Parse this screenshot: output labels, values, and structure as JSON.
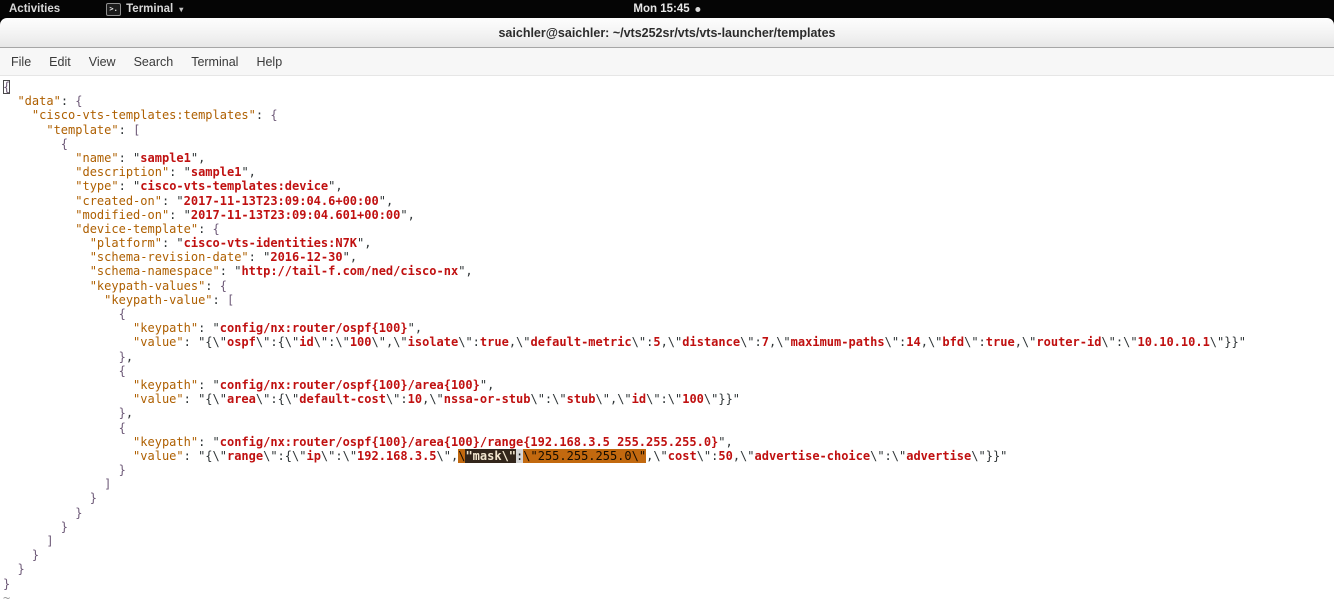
{
  "top_bar": {
    "activities": "Activities",
    "app_menu": "Terminal",
    "clock": "Mon 15:45"
  },
  "window": {
    "title": "saichler@saichler: ~/vts252sr/vts/vts-launcher/templates"
  },
  "menu_bar": {
    "items": [
      "File",
      "Edit",
      "View",
      "Search",
      "Terminal",
      "Help"
    ]
  },
  "colors": {
    "key": "#ae5f00",
    "str": "#c01010",
    "brace": "#6e5a78",
    "pun": "#2e3436",
    "sel": "#c2690f",
    "match": "#33261b"
  },
  "terminal": {
    "search_match": "\"mask\\\"",
    "selection_text": "\\\"mask\\\":\\\"255.255.255.0\\\"",
    "lines": [
      [
        [
          "b",
          "{",
          "cur"
        ]
      ],
      [
        [
          "p",
          "  "
        ],
        [
          "k",
          "\"data\""
        ],
        [
          "p",
          ": "
        ],
        [
          "b",
          "{"
        ]
      ],
      [
        [
          "p",
          "    "
        ],
        [
          "k",
          "\"cisco-vts-templates:templates\""
        ],
        [
          "p",
          ": "
        ],
        [
          "b",
          "{"
        ]
      ],
      [
        [
          "p",
          "      "
        ],
        [
          "k",
          "\"template\""
        ],
        [
          "p",
          ": "
        ],
        [
          "b",
          "["
        ]
      ],
      [
        [
          "p",
          "        "
        ],
        [
          "b",
          "{"
        ]
      ],
      [
        [
          "p",
          "          "
        ],
        [
          "k",
          "\"name\""
        ],
        [
          "p",
          ": \""
        ],
        [
          "s",
          "sample1"
        ],
        [
          "p",
          "\","
        ]
      ],
      [
        [
          "p",
          "          "
        ],
        [
          "k",
          "\"description\""
        ],
        [
          "p",
          ": \""
        ],
        [
          "s",
          "sample1"
        ],
        [
          "p",
          "\","
        ]
      ],
      [
        [
          "p",
          "          "
        ],
        [
          "k",
          "\"type\""
        ],
        [
          "p",
          ": \""
        ],
        [
          "s",
          "cisco-vts-templates:device"
        ],
        [
          "p",
          "\","
        ]
      ],
      [
        [
          "p",
          "          "
        ],
        [
          "k",
          "\"created-on\""
        ],
        [
          "p",
          ": \""
        ],
        [
          "s",
          "2017-11-13T23:09:04.6+00:00"
        ],
        [
          "p",
          "\","
        ]
      ],
      [
        [
          "p",
          "          "
        ],
        [
          "k",
          "\"modified-on\""
        ],
        [
          "p",
          ": \""
        ],
        [
          "s",
          "2017-11-13T23:09:04.601+00:00"
        ],
        [
          "p",
          "\","
        ]
      ],
      [
        [
          "p",
          "          "
        ],
        [
          "k",
          "\"device-template\""
        ],
        [
          "p",
          ": "
        ],
        [
          "b",
          "{"
        ]
      ],
      [
        [
          "p",
          "            "
        ],
        [
          "k",
          "\"platform\""
        ],
        [
          "p",
          ": \""
        ],
        [
          "s",
          "cisco-vts-identities:N7K"
        ],
        [
          "p",
          "\","
        ]
      ],
      [
        [
          "p",
          "            "
        ],
        [
          "k",
          "\"schema-revision-date\""
        ],
        [
          "p",
          ": \""
        ],
        [
          "s",
          "2016-12-30"
        ],
        [
          "p",
          "\","
        ]
      ],
      [
        [
          "p",
          "            "
        ],
        [
          "k",
          "\"schema-namespace\""
        ],
        [
          "p",
          ": \""
        ],
        [
          "s",
          "http://tail-f.com/ned/cisco-nx"
        ],
        [
          "p",
          "\","
        ]
      ],
      [
        [
          "p",
          "            "
        ],
        [
          "k",
          "\"keypath-values\""
        ],
        [
          "p",
          ": "
        ],
        [
          "b",
          "{"
        ]
      ],
      [
        [
          "p",
          "              "
        ],
        [
          "k",
          "\"keypath-value\""
        ],
        [
          "p",
          ": "
        ],
        [
          "b",
          "["
        ]
      ],
      [
        [
          "p",
          "                "
        ],
        [
          "b",
          "{"
        ]
      ],
      [
        [
          "p",
          "                  "
        ],
        [
          "k",
          "\"keypath\""
        ],
        [
          "p",
          ": \""
        ],
        [
          "s",
          "config/nx:router/ospf{100}"
        ],
        [
          "p",
          "\","
        ]
      ],
      [
        [
          "p",
          "                  "
        ],
        [
          "k",
          "\"value\""
        ],
        [
          "p",
          ": \"{\\\""
        ],
        [
          "s",
          "ospf"
        ],
        [
          "p",
          "\\\":{\\\""
        ],
        [
          "s",
          "id"
        ],
        [
          "p",
          "\\\":\\\""
        ],
        [
          "s",
          "100"
        ],
        [
          "p",
          "\\\",\\\""
        ],
        [
          "s",
          "isolate"
        ],
        [
          "p",
          "\\\":"
        ],
        [
          "s",
          "true"
        ],
        [
          "p",
          ",\\\""
        ],
        [
          "s",
          "default-metric"
        ],
        [
          "p",
          "\\\":"
        ],
        [
          "s",
          "5"
        ],
        [
          "p",
          ",\\\""
        ],
        [
          "s",
          "distance"
        ],
        [
          "p",
          "\\\":"
        ],
        [
          "s",
          "7"
        ],
        [
          "p",
          ",\\\""
        ],
        [
          "s",
          "maximum-paths"
        ],
        [
          "p",
          "\\\":"
        ],
        [
          "s",
          "14"
        ],
        [
          "p",
          ",\\\""
        ],
        [
          "s",
          "bfd"
        ],
        [
          "p",
          "\\\":"
        ],
        [
          "s",
          "true"
        ],
        [
          "p",
          ",\\\""
        ],
        [
          "s",
          "router-id"
        ],
        [
          "p",
          "\\\":\\\""
        ],
        [
          "s",
          "10.10.10.1"
        ],
        [
          "p",
          "\\\"}}\""
        ]
      ],
      [
        [
          "p",
          "                "
        ],
        [
          "b",
          "}"
        ],
        [
          "p",
          ","
        ]
      ],
      [
        [
          "p",
          "                "
        ],
        [
          "b",
          "{"
        ]
      ],
      [
        [
          "p",
          "                  "
        ],
        [
          "k",
          "\"keypath\""
        ],
        [
          "p",
          ": \""
        ],
        [
          "s",
          "config/nx:router/ospf{100}/area{100}"
        ],
        [
          "p",
          "\","
        ]
      ],
      [
        [
          "p",
          "                  "
        ],
        [
          "k",
          "\"value\""
        ],
        [
          "p",
          ": \"{\\\""
        ],
        [
          "s",
          "area"
        ],
        [
          "p",
          "\\\":{\\\""
        ],
        [
          "s",
          "default-cost"
        ],
        [
          "p",
          "\\\":"
        ],
        [
          "s",
          "10"
        ],
        [
          "p",
          ",\\\""
        ],
        [
          "s",
          "nssa-or-stub"
        ],
        [
          "p",
          "\\\":\\\""
        ],
        [
          "s",
          "stub"
        ],
        [
          "p",
          "\\\",\\\""
        ],
        [
          "s",
          "id"
        ],
        [
          "p",
          "\\\":\\\""
        ],
        [
          "s",
          "100"
        ],
        [
          "p",
          "\\\"}}\""
        ]
      ],
      [
        [
          "p",
          "                "
        ],
        [
          "b",
          "}"
        ],
        [
          "p",
          ","
        ]
      ],
      [
        [
          "p",
          "                "
        ],
        [
          "b",
          "{"
        ]
      ],
      [
        [
          "p",
          "                  "
        ],
        [
          "k",
          "\"keypath\""
        ],
        [
          "p",
          ": \""
        ],
        [
          "s",
          "config/nx:router/ospf{100}/area{100}/range{192.168.3.5 255.255.255.0}"
        ],
        [
          "p",
          "\","
        ]
      ],
      [
        [
          "p",
          "                  "
        ],
        [
          "k",
          "\"value\""
        ],
        [
          "p",
          ": \"{\\\""
        ],
        [
          "s",
          "range"
        ],
        [
          "p",
          "\\\":{\\\""
        ],
        [
          "s",
          "ip"
        ],
        [
          "p",
          "\\\":\\\""
        ],
        [
          "s",
          "192.168.3.5"
        ],
        [
          "p",
          "\\\","
        ],
        [
          "so",
          "\\"
        ],
        [
          "sd",
          "\"mask\\\""
        ],
        [
          "sg",
          ":"
        ],
        [
          "so",
          "\\\"255.255.255.0\\\""
        ],
        [
          "p",
          ",\\\""
        ],
        [
          "s",
          "cost"
        ],
        [
          "p",
          "\\\":"
        ],
        [
          "s",
          "50"
        ],
        [
          "p",
          ",\\\""
        ],
        [
          "s",
          "advertise-choice"
        ],
        [
          "p",
          "\\\":\\\""
        ],
        [
          "s",
          "advertise"
        ],
        [
          "p",
          "\\\"}}\""
        ]
      ],
      [
        [
          "p",
          "                "
        ],
        [
          "b",
          "}"
        ]
      ],
      [
        [
          "p",
          "              "
        ],
        [
          "b",
          "]"
        ]
      ],
      [
        [
          "p",
          "            "
        ],
        [
          "b",
          "}"
        ]
      ],
      [
        [
          "p",
          "          "
        ],
        [
          "b",
          "}"
        ]
      ],
      [
        [
          "p",
          "        "
        ],
        [
          "b",
          "}"
        ]
      ],
      [
        [
          "p",
          "      "
        ],
        [
          "b",
          "]"
        ]
      ],
      [
        [
          "p",
          "    "
        ],
        [
          "b",
          "}"
        ]
      ],
      [
        [
          "p",
          "  "
        ],
        [
          "b",
          "}"
        ]
      ],
      [
        [
          "b",
          "}"
        ]
      ],
      [
        [
          "t",
          "~"
        ]
      ]
    ]
  }
}
